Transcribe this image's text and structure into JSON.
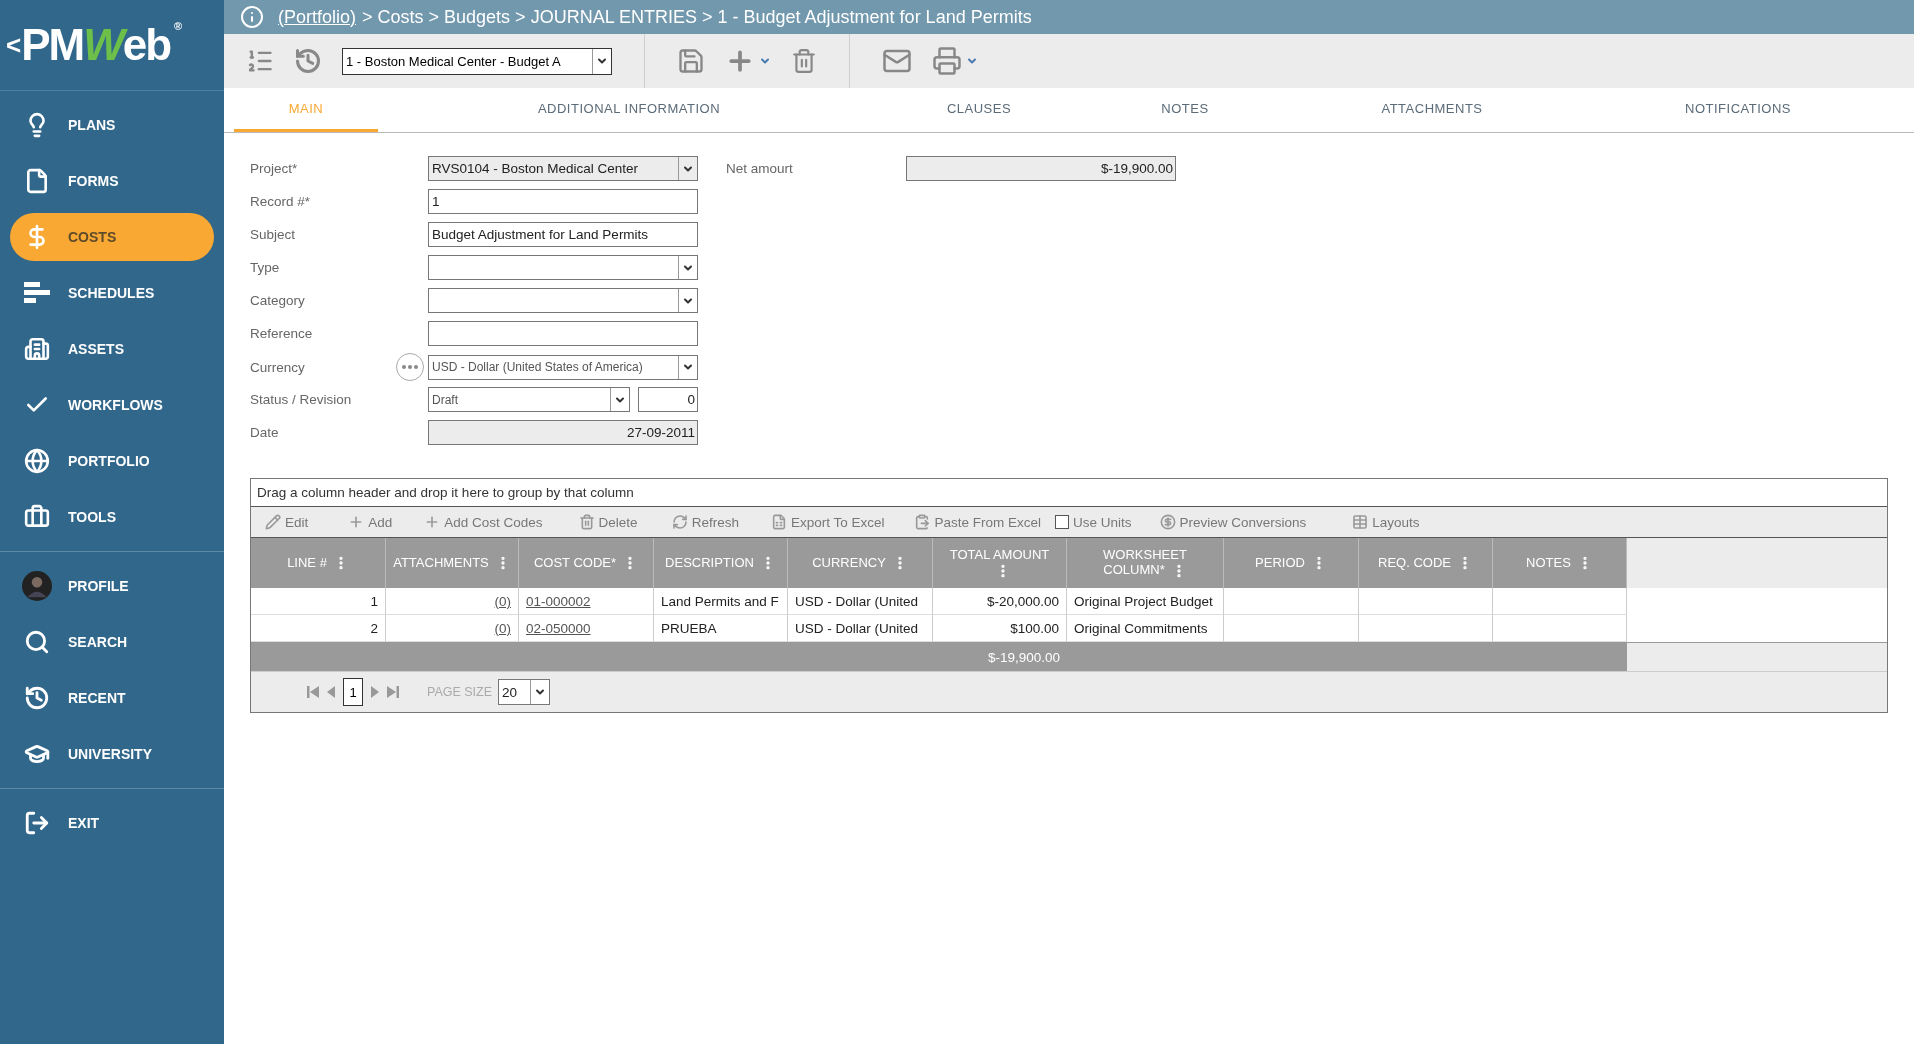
{
  "logo": {
    "back": "<",
    "part_1": "PM",
    "part_2": "W",
    "part_3": "eb",
    "mark": "®"
  },
  "sidebar": {
    "items": [
      {
        "label": "PLANS",
        "selected": false
      },
      {
        "label": "FORMS",
        "selected": false
      },
      {
        "label": "COSTS",
        "selected": true
      },
      {
        "label": "SCHEDULES",
        "selected": false
      },
      {
        "label": "ASSETS",
        "selected": false
      },
      {
        "label": "WORKFLOWS",
        "selected": false
      },
      {
        "label": "PORTFOLIO",
        "selected": false
      },
      {
        "label": "TOOLS",
        "selected": false
      }
    ],
    "user_items": [
      {
        "label": "PROFILE",
        "kind": "avatar"
      },
      {
        "label": "SEARCH",
        "kind": "icon"
      },
      {
        "label": "RECENT",
        "kind": "icon"
      },
      {
        "label": "UNIVERSITY",
        "kind": "icon"
      }
    ],
    "exit": {
      "label": "EXIT"
    }
  },
  "breadcrumb": {
    "link": "(Portfolio)",
    "path": "> Costs > Budgets > JOURNAL ENTRIES > 1 - Budget Adjustment for Land Permits"
  },
  "toolbar": {
    "record_select": "1 - Boston Medical Center - Budget A"
  },
  "tabs": [
    {
      "label": "MAIN",
      "selected": true
    },
    {
      "label": "ADDITIONAL INFORMATION",
      "selected": false
    },
    {
      "label": "CLAUSES",
      "selected": false
    },
    {
      "label": "NOTES",
      "selected": false
    },
    {
      "label": "ATTACHMENTS",
      "selected": false
    },
    {
      "label": "NOTIFICATIONS",
      "selected": false
    }
  ],
  "form": {
    "fields": [
      {
        "label": "Project*",
        "kind": "select",
        "value": "RVS0104 - Boston Medical Center",
        "disabled": true
      },
      {
        "label": "Record #*",
        "kind": "text",
        "value": "1"
      },
      {
        "label": "Subject",
        "kind": "text",
        "value": "Budget Adjustment for Land Permits"
      },
      {
        "label": "Type",
        "kind": "select"
      },
      {
        "label": "Category",
        "kind": "select"
      },
      {
        "label": "Reference",
        "kind": "text"
      },
      {
        "label": "Currency",
        "kind": "lookup",
        "value": "USD - Dollar (United States of America)"
      },
      {
        "label": "Status / Revision",
        "kind": "status",
        "value": "Draft",
        "revision": "0"
      },
      {
        "label": "Date",
        "kind": "readonly",
        "value": "27-09-2011"
      }
    ],
    "net_amount": {
      "label": "Net amourt",
      "value": "$-19,900.00"
    }
  },
  "grid": {
    "group_hint": "Drag a column header and drop it here to group by that column",
    "actions": [
      {
        "label": "Edit",
        "kind": "button"
      },
      {
        "label": "Add",
        "kind": "button"
      },
      {
        "label": "Add Cost Codes",
        "kind": "button"
      },
      {
        "label": "Delete",
        "kind": "button"
      },
      {
        "label": "Refresh",
        "kind": "button"
      },
      {
        "label": "Export To Excel",
        "kind": "button"
      },
      {
        "label": "Paste From Excel",
        "kind": "button"
      },
      {
        "label": "Use Units",
        "kind": "checkbox",
        "checked": false
      },
      {
        "label": "Preview Conversions",
        "kind": "button"
      },
      {
        "label": "Layouts",
        "kind": "button"
      }
    ],
    "columns": [
      "LINE #",
      "ATTACHMENTS",
      "COST CODE*",
      "DESCRIPTION",
      "CURRENCY",
      "TOTAL AMOUNT",
      "WORKSHEET COLUMN*",
      "PERIOD",
      "REQ. CODE",
      "NOTES"
    ],
    "rows": [
      [
        "1",
        "(0)",
        "01-000002",
        "Land Permits and F",
        "USD - Dollar (United",
        "$-20,000.00",
        "Original Project Budget",
        "",
        "",
        ""
      ],
      [
        "2",
        "(0)",
        "02-050000",
        "PRUEBA",
        "USD - Dollar (United",
        "$100.00",
        "Original Commitments",
        "",
        "",
        ""
      ]
    ],
    "total": "$-19,900.00",
    "pager": {
      "page": "1",
      "page_size_label": "PAGE SIZE",
      "page_size": "20"
    }
  }
}
